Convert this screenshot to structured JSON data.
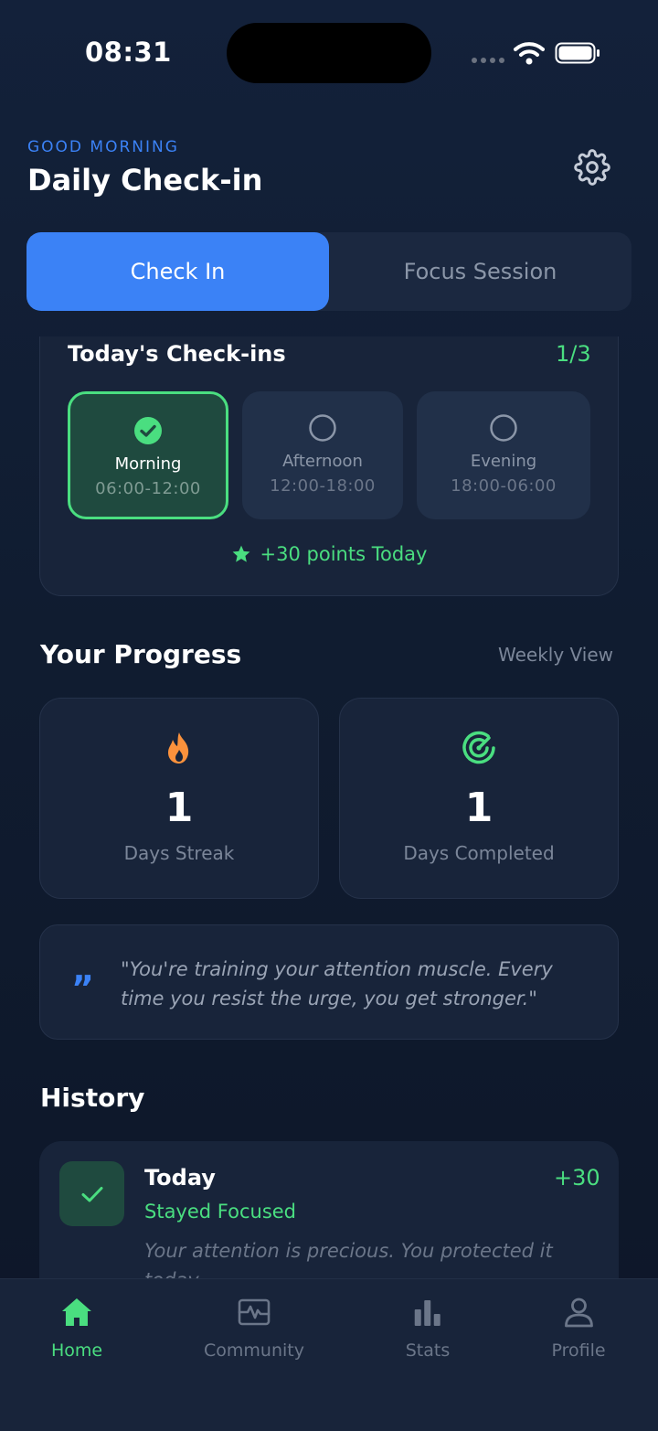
{
  "status_bar": {
    "time": "08:31"
  },
  "header": {
    "greeting": "GOOD MORNING",
    "title": "Daily Check-in",
    "settings_icon": "gear-icon"
  },
  "tabs": [
    {
      "label": "Check In",
      "active": true
    },
    {
      "label": "Focus Session",
      "active": false
    }
  ],
  "checkins": {
    "title": "Today's Check-ins",
    "count": "1/3",
    "slots": [
      {
        "name": "Morning",
        "time": "06:00-12:00",
        "done": true
      },
      {
        "name": "Afternoon",
        "time": "12:00-18:00",
        "done": false
      },
      {
        "name": "Evening",
        "time": "18:00-06:00",
        "done": false
      }
    ],
    "points": "+30 points Today"
  },
  "progress": {
    "title": "Your Progress",
    "view_label": "Weekly View",
    "stats": [
      {
        "value": "1",
        "label": "Days Streak",
        "icon": "flame-icon",
        "color": "#fb923c"
      },
      {
        "value": "1",
        "label": "Days Completed",
        "icon": "target-icon",
        "color": "#4ade80"
      }
    ]
  },
  "quote": {
    "mark": "”",
    "text": "\"You're training your attention muscle. Every time you resist the urge, you get stronger.\""
  },
  "history": {
    "title": "History",
    "items": [
      {
        "day": "Today",
        "points": "+30",
        "status": "Stayed Focused",
        "note": "Your attention is precious. You protected it today."
      }
    ]
  },
  "nav": [
    {
      "label": "Home",
      "icon": "home-icon",
      "active": true
    },
    {
      "label": "Community",
      "icon": "pulse-icon",
      "active": false
    },
    {
      "label": "Stats",
      "icon": "bar-chart-icon",
      "active": false
    },
    {
      "label": "Profile",
      "icon": "person-icon",
      "active": false
    }
  ],
  "colors": {
    "accent": "#3b82f6",
    "success": "#4ade80",
    "streak": "#fb923c",
    "card": "#18243a"
  }
}
